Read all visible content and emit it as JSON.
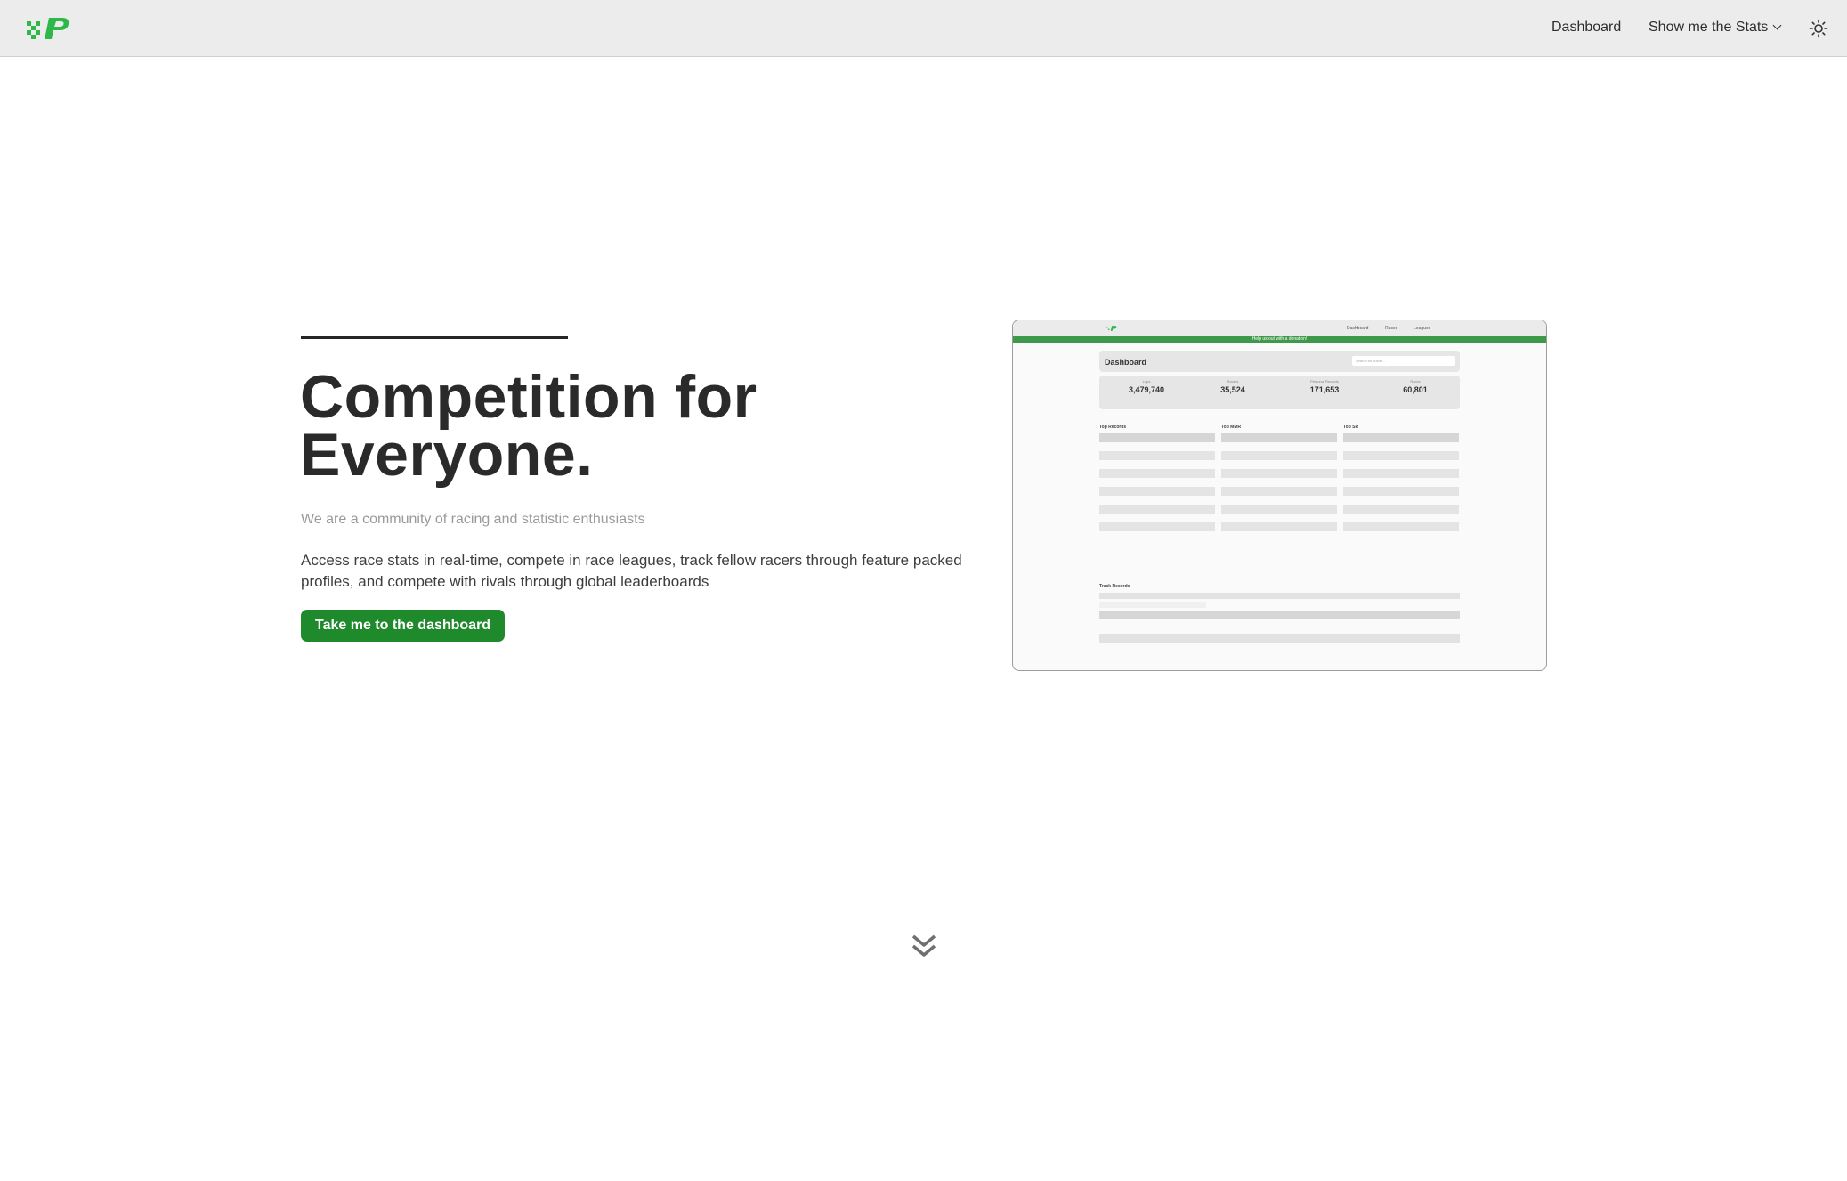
{
  "navbar": {
    "dashboard_label": "Dashboard",
    "stats_label": "Show me the Stats"
  },
  "hero": {
    "headline_line1": "Competition for",
    "headline_line2": "Everyone.",
    "tagline": "We are a community of racing and statistic enthusiasts",
    "description": "Access race stats in real-time, compete in race leagues, track fellow racers through feature packed profiles, and compete with rivals through global leaderboards",
    "cta_label": "Take me to the dashboard"
  },
  "preview": {
    "banner": "Help us out with a donation!",
    "nav_items": [
      "Dashboard",
      "Races",
      "Leagues"
    ],
    "title": "Dashboard",
    "search_placeholder": "Search for Racer...",
    "stats": [
      {
        "label": "Laps",
        "value": "3,479,740"
      },
      {
        "label": "Racers",
        "value": "35,524"
      },
      {
        "label": "Personal Records",
        "value": "171,653"
      },
      {
        "label": "Races",
        "value": "60,801"
      }
    ],
    "sections": [
      "Top Records",
      "Top MMR",
      "Top SR",
      "Track Records"
    ]
  },
  "colors": {
    "brand_green": "#1e8a2c",
    "logo_green": "#2eb84a"
  },
  "icons": [
    "logo-icon",
    "chevron-down-icon",
    "sun-icon",
    "double-chevron-down-icon"
  ]
}
